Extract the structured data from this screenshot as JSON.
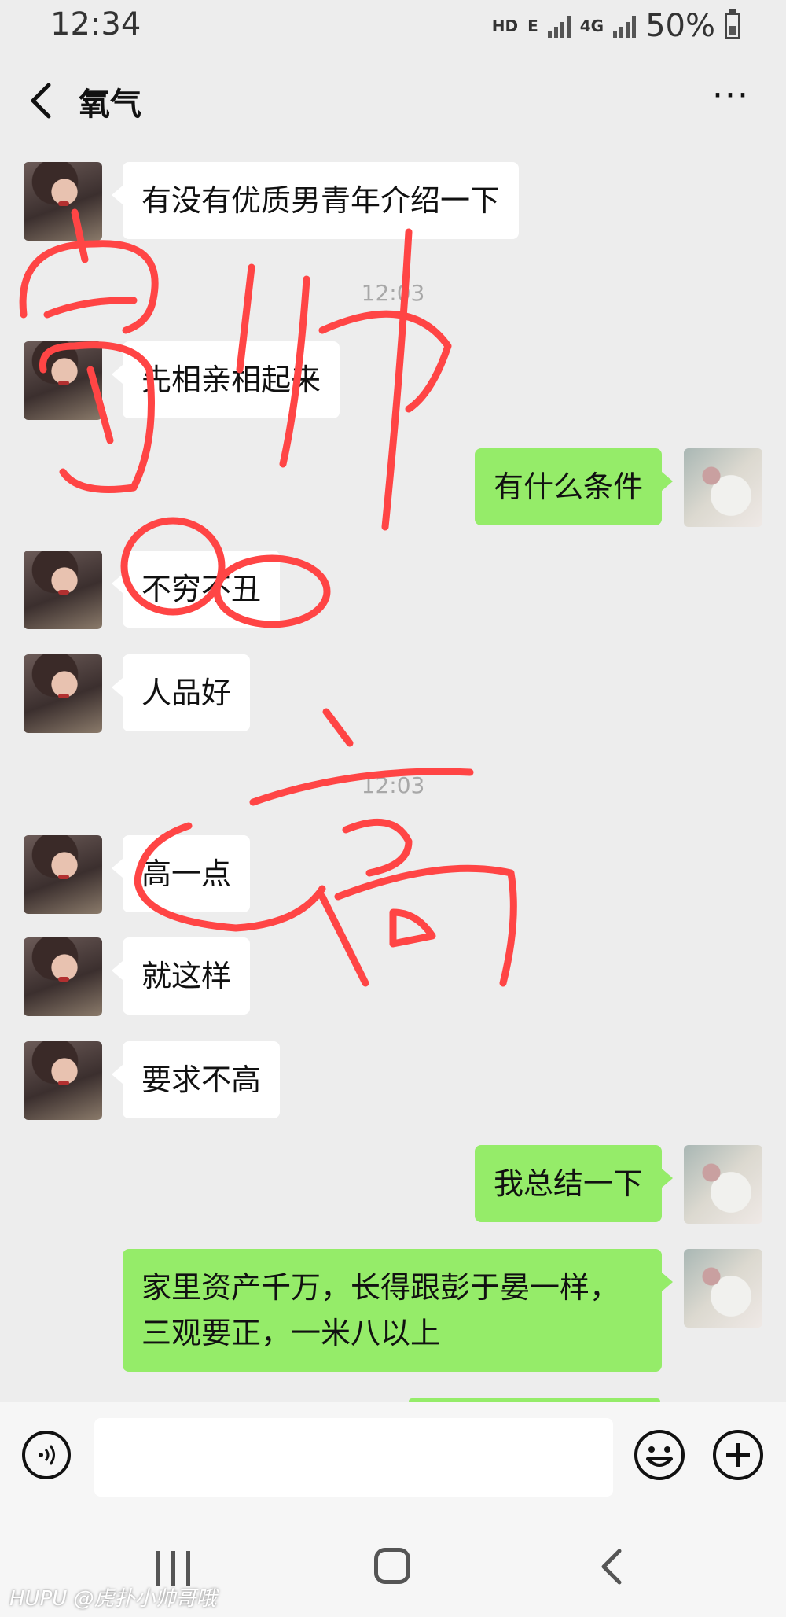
{
  "status_bar": {
    "time": "12:34",
    "network_hd": "HD",
    "network_e": "E",
    "network_4g": "4G",
    "battery": "50%",
    "battery_level": 0.5
  },
  "header": {
    "back_icon": "chevron-left-icon",
    "title": "氧气",
    "more_label": "···"
  },
  "messages": [
    {
      "type": "text",
      "side": "left",
      "text": "有没有优质男青年介绍一下"
    },
    {
      "type": "time",
      "text": "12:03"
    },
    {
      "type": "text",
      "side": "left",
      "text": "先相亲相起来"
    },
    {
      "type": "text",
      "side": "right",
      "text": "有什么条件"
    },
    {
      "type": "text",
      "side": "left",
      "text": "不穷不丑"
    },
    {
      "type": "text",
      "side": "left",
      "text": "人品好"
    },
    {
      "type": "time",
      "text": "12:03"
    },
    {
      "type": "text",
      "side": "left",
      "text": "高一点"
    },
    {
      "type": "text",
      "side": "left",
      "text": "就这样"
    },
    {
      "type": "text",
      "side": "left",
      "text": "要求不高"
    },
    {
      "type": "text",
      "side": "right",
      "text": "我总结一下"
    },
    {
      "type": "text",
      "side": "right",
      "text": "家里资产千万，长得跟彭于晏一样，\n三观要正，一米八以上"
    }
  ],
  "annotations": {
    "word_1": "富",
    "word_2": "帅",
    "word_3": "高",
    "color": "#ff4040"
  },
  "input_bar": {
    "voice_icon": "voice-icon",
    "input_value": "",
    "emoji_icon": "emoji-icon",
    "add_icon": "plus-icon"
  },
  "nav_bar": {
    "recents_icon": "recents-icon",
    "home_icon": "home-icon",
    "back_icon": "back-icon"
  },
  "watermark": "HUPU @虎扑小帅哥哦",
  "colors": {
    "background": "#ededed",
    "bubble_self": "#95ec69",
    "bubble_other": "#ffffff",
    "scribble": "#ff4040"
  }
}
